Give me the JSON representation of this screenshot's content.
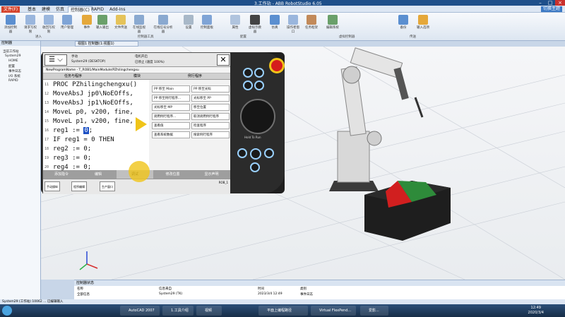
{
  "window": {
    "title": "3.工作站 - ABB RobotStudio 6.05"
  },
  "tabs": [
    {
      "label": "文件(F)",
      "type": "file"
    },
    {
      "label": "基本"
    },
    {
      "label": "建模"
    },
    {
      "label": "仿真"
    },
    {
      "label": "控制器(C)",
      "active": true
    },
    {
      "label": "RAPID"
    },
    {
      "label": "Add-Ins"
    }
  ],
  "ribbon_help": "切换主题",
  "ribbon_buttons": [
    "添加控制器",
    "请求写权限",
    "收回写权限",
    "用户管理",
    "事件",
    "输入输出",
    "文件传送",
    "在线监视器",
    "在线信号分析器",
    "设置",
    "控制面板",
    "属性",
    "虚拟示教器",
    "仿真",
    "操作者窗口",
    "任务框架",
    "编辑系统",
    "备份",
    "输入选项"
  ],
  "ribbon_groups": [
    "进入",
    "控制器工具",
    "配置",
    "虚拟控制器",
    "传送"
  ],
  "browser": {
    "header": "控制器",
    "items": [
      "当前工作站",
      "System29",
      "HOME",
      "配置",
      "事件日志",
      "I/O 系统",
      "RAPID"
    ]
  },
  "doc_tab": "视图1 控制器(1:视图1)",
  "pendant": {
    "info": [
      "手动",
      "System29 (DESKTOP)",
      "电机开启",
      "已停止 (速度 100%)"
    ],
    "path": "NewProgramName - T_ROB1/MainModule/PZhilingchengxu",
    "col_heads": [
      "任务与程序",
      "模块",
      "例行程序"
    ],
    "line_numbers": [
      "11",
      "12",
      "13",
      "14",
      "15",
      "16",
      "17",
      "18",
      "19",
      "20"
    ],
    "code": [
      "PROC PZhilingchengxu()",
      "  MoveAbsJ jp0\\NoEOffs,",
      "  MoveAbsJ jp1\\NoEOffs,",
      "  MoveL p0, v200, fine,",
      "  MoveL p1, v200, fine,",
      "  reg1 := 0;",
      "  IF reg1 = 0 THEN",
      "    reg2 := 0;",
      "    reg3 := 0;",
      "    reg4 := 0;"
    ],
    "highlight_value": "0",
    "instr_buttons": [
      "PP 移至 Main",
      "PP 移至光标",
      "PP 移至例行程序...",
      "光标移至 PP",
      "光标移至 MP",
      "移至位置",
      "调用例行程序...",
      "取消调用例行程序",
      "查看值",
      "检查程序",
      "查看系统数据",
      "搜索例行程序"
    ],
    "bottom_bar": [
      "添加指令",
      "编辑",
      "调试",
      "修改位置",
      "显示声明"
    ],
    "task_bar": [
      "手动操纵",
      "程序编辑",
      "生产窗口"
    ],
    "rob_label": "ROB_1",
    "hold_label": "Hold To Run"
  },
  "output": {
    "header": "控制器状态",
    "cols": [
      "名称",
      "信息来自",
      "时间",
      "类别"
    ],
    "rows": [
      [
        "全部信息",
        "System29 (TK)",
        "2023/3/4 12:49",
        "事件日志"
      ]
    ]
  },
  "statusbar": "System29 (工作站) 10062 ... 已编辑输入",
  "taskbar": {
    "tasks": [
      "AutoCAD 2007",
      "1.工具介绍",
      "视频",
      "平面上编程路径",
      "Virtual FlexPend...",
      "爱影..."
    ],
    "time": "12:49",
    "date": "2020/3/4"
  },
  "colors": {
    "accent": "#1e4f8a",
    "pendant_body": "#1f1f1f",
    "highlight": "#1b4fc4",
    "enable_button": "#f0c419"
  }
}
